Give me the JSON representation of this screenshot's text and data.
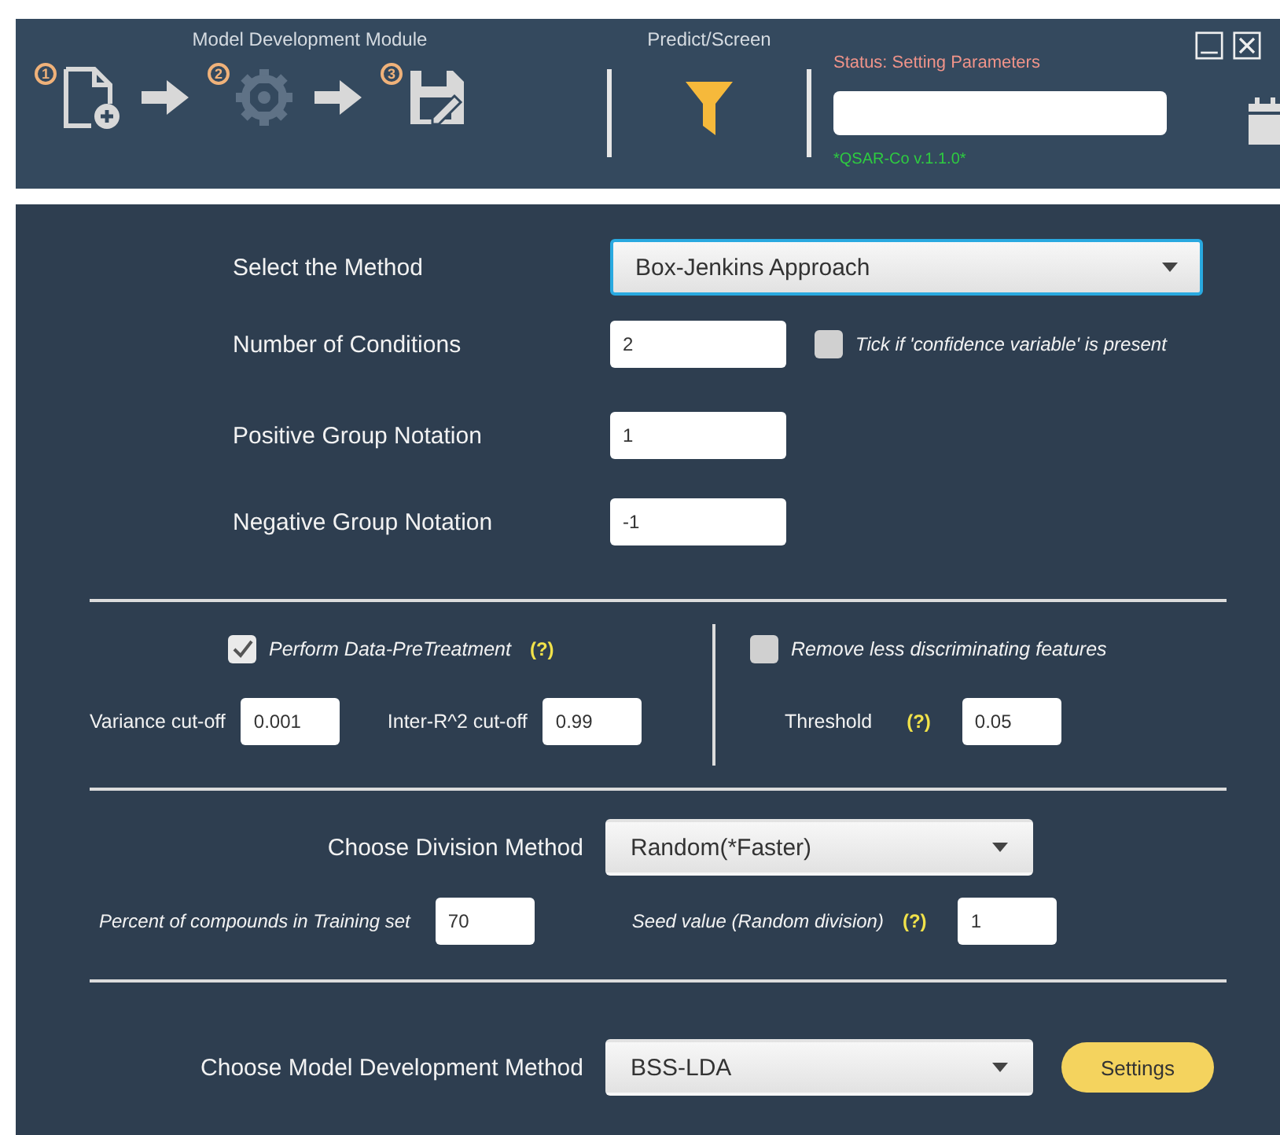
{
  "header": {
    "module_title": "Model Development Module",
    "steps": [
      {
        "number": "1",
        "kind": "new-file",
        "disabled": false
      },
      {
        "number": "2",
        "kind": "settings",
        "disabled": true
      },
      {
        "number": "3",
        "kind": "save",
        "disabled": false
      }
    ],
    "predict_title": "Predict/Screen",
    "status": "Status: Setting Parameters",
    "progress": {
      "level": 0
    },
    "version": "*QSAR-Co v.1.1.0*"
  },
  "method": {
    "label": "Select the Method",
    "value": "Box-Jenkins Approach",
    "focused": true
  },
  "conditions": {
    "label": "Number of Conditions",
    "value": "2",
    "confidence": {
      "label": "Tick if 'confidence variable' is present",
      "checked": false
    }
  },
  "positive": {
    "label": "Positive Group Notation",
    "value": "1"
  },
  "negative": {
    "label": "Negative Group Notation",
    "value": "-1"
  },
  "pretreatment": {
    "label": "Perform Data-PreTreatment",
    "checked": true,
    "help": "(?)",
    "variance": {
      "label": "Variance cut-off",
      "value": "0.001"
    },
    "inter_r2": {
      "label": "Inter-R^2 cut-off",
      "value": "0.99"
    }
  },
  "feature_removal": {
    "label": "Remove less discriminating features",
    "checked": false,
    "threshold": {
      "label": "Threshold",
      "help": "(?)",
      "value": "0.05"
    }
  },
  "division": {
    "label": "Choose Division Method",
    "value": "Random(*Faster)",
    "percent": {
      "label": "Percent of compounds in Training set",
      "value": "70"
    },
    "seed": {
      "label": "Seed value (Random division)",
      "help": "(?)",
      "value": "1"
    }
  },
  "model": {
    "label": "Choose Model Development Method",
    "value": "BSS-LDA",
    "settings": "Settings"
  }
}
